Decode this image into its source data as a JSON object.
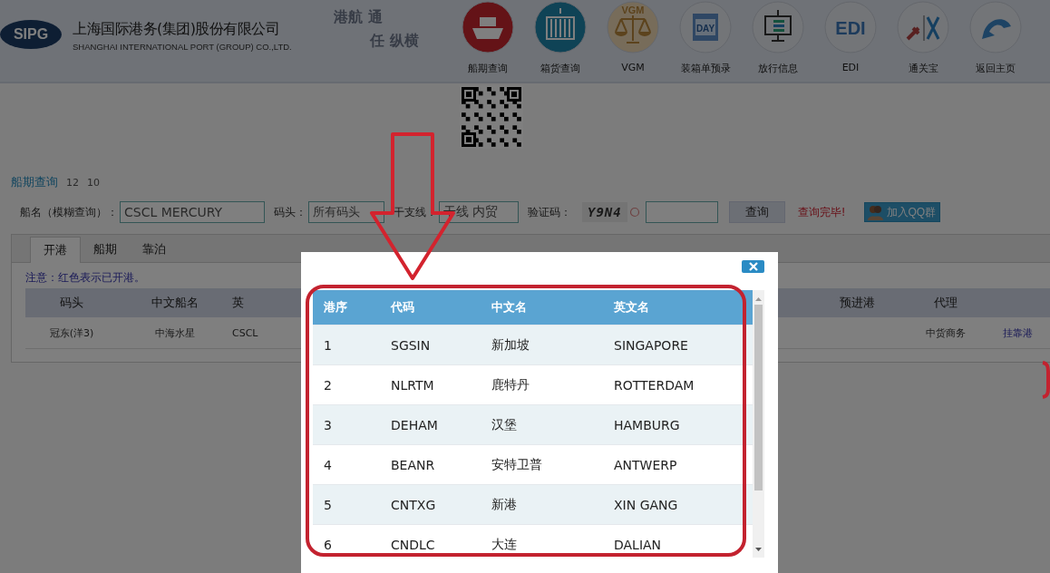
{
  "header": {
    "logo": "SIPG",
    "company_name": "上海国际港务(集团)股份有限公司",
    "company_name_en": "SHANGHAI INTERNATIONAL PORT (GROUP) CO.,LTD.",
    "slogan": [
      "港航 通",
      "任 纵横"
    ]
  },
  "nav": [
    {
      "label": "船期查询",
      "kind": "ship"
    },
    {
      "label": "箱货查询",
      "kind": "container"
    },
    {
      "label": "VGM",
      "kind": "scales",
      "icon_text": "VGM"
    },
    {
      "label": "装箱单预录",
      "kind": "calendar",
      "icon_text": "DAY"
    },
    {
      "label": "放行信息",
      "kind": "monitor"
    },
    {
      "label": "EDI",
      "kind": "edi",
      "icon_text": "EDI"
    },
    {
      "label": "通关宝",
      "kind": "tools"
    },
    {
      "label": "返回主页",
      "kind": "back"
    }
  ],
  "page_title": "船期查询",
  "page_numbers": [
    "12",
    "10"
  ],
  "search_form": {
    "vessel_label": "船名（模糊查询）：",
    "vessel_value": "CSCL MERCURY",
    "terminal_label": "码头：",
    "terminal_value": "所有码头",
    "line_label": "干支线：",
    "line_value": "干线 内贸",
    "captcha_label": "验证码：",
    "captcha_text": "Y9N4",
    "query_button": "查询",
    "status": "查询完毕!",
    "qq_button": "加入QQ群"
  },
  "tabs": [
    {
      "label": "开港",
      "selected": true
    },
    {
      "label": "船期",
      "selected": false
    },
    {
      "label": "靠泊",
      "selected": false
    }
  ],
  "notice": "注意：红色表示已开港。",
  "schedule_table": {
    "columns": [
      "码头",
      "中文船名",
      "英",
      "预进港",
      "代理"
    ],
    "rows": [
      {
        "cells": [
          "冠东(洋3)",
          "中海水星",
          "CSCL",
          "",
          "中货商务"
        ],
        "link": "挂靠港"
      }
    ]
  },
  "port_dialog": {
    "columns": [
      "港序",
      "代码",
      "中文名",
      "英文名"
    ],
    "rows": [
      [
        "1",
        "SGSIN",
        "新加坡",
        "SINGAPORE"
      ],
      [
        "2",
        "NLRTM",
        "鹿特丹",
        "ROTTERDAM"
      ],
      [
        "3",
        "DEHAM",
        "汉堡",
        "HAMBURG"
      ],
      [
        "4",
        "BEANR",
        "安特卫普",
        "ANTWERP"
      ],
      [
        "5",
        "CNTXG",
        "新港",
        "XIN GANG"
      ],
      [
        "6",
        "CNDLC",
        "大连",
        "DALIAN"
      ]
    ]
  }
}
